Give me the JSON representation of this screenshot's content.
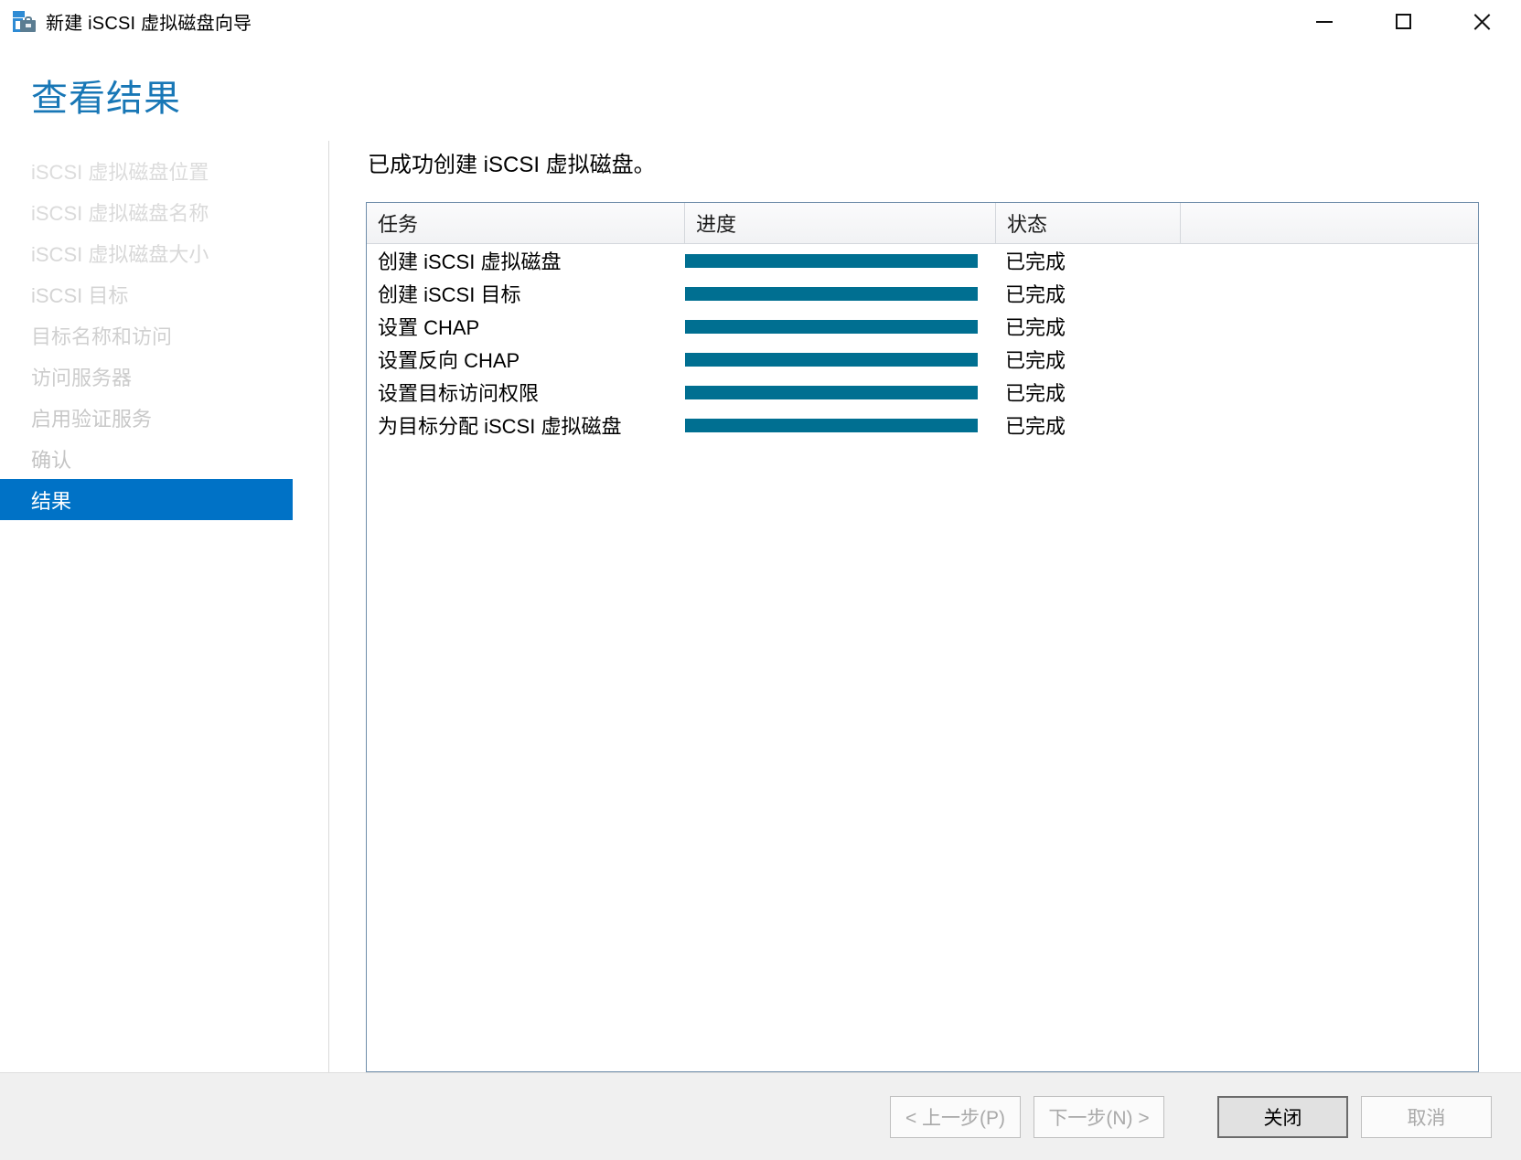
{
  "window": {
    "title": "新建 iSCSI 虚拟磁盘向导",
    "icon": "iscsi-wizard-icon",
    "controls": {
      "minimize": "minimize-icon",
      "maximize": "maximize-icon",
      "close": "close-icon"
    }
  },
  "page": {
    "title": "查看结果",
    "title_color": "#1877b6"
  },
  "sidebar": {
    "items": [
      {
        "label": "iSCSI 虚拟磁盘位置",
        "selected": false
      },
      {
        "label": "iSCSI 虚拟磁盘名称",
        "selected": false
      },
      {
        "label": "iSCSI 虚拟磁盘大小",
        "selected": false
      },
      {
        "label": "iSCSI 目标",
        "selected": false
      },
      {
        "label": "目标名称和访问",
        "selected": false
      },
      {
        "label": "访问服务器",
        "selected": false
      },
      {
        "label": "启用验证服务",
        "selected": false
      },
      {
        "label": "确认",
        "selected": false
      },
      {
        "label": "结果",
        "selected": true
      }
    ],
    "selected_color": "#0072c6"
  },
  "main": {
    "intro": "已成功创建 iSCSI 虚拟磁盘。",
    "grid": {
      "columns": [
        "任务",
        "进度",
        "状态",
        ""
      ],
      "progress_color": "#006f91",
      "rows": [
        {
          "task": "创建 iSCSI 虚拟磁盘",
          "progress": 100,
          "status": "已完成"
        },
        {
          "task": "创建 iSCSI 目标",
          "progress": 100,
          "status": "已完成"
        },
        {
          "task": "设置 CHAP",
          "progress": 100,
          "status": "已完成"
        },
        {
          "task": "设置反向 CHAP",
          "progress": 100,
          "status": "已完成"
        },
        {
          "task": "设置目标访问权限",
          "progress": 100,
          "status": "已完成"
        },
        {
          "task": "为目标分配 iSCSI 虚拟磁盘",
          "progress": 100,
          "status": "已完成"
        }
      ]
    }
  },
  "footer": {
    "buttons": [
      {
        "label": "< 上一步(P)",
        "state": "disabled"
      },
      {
        "label": "下一步(N) >",
        "state": "disabled"
      },
      {
        "label": "关闭",
        "state": "default-focused"
      },
      {
        "label": "取消",
        "state": "disabled"
      }
    ]
  }
}
